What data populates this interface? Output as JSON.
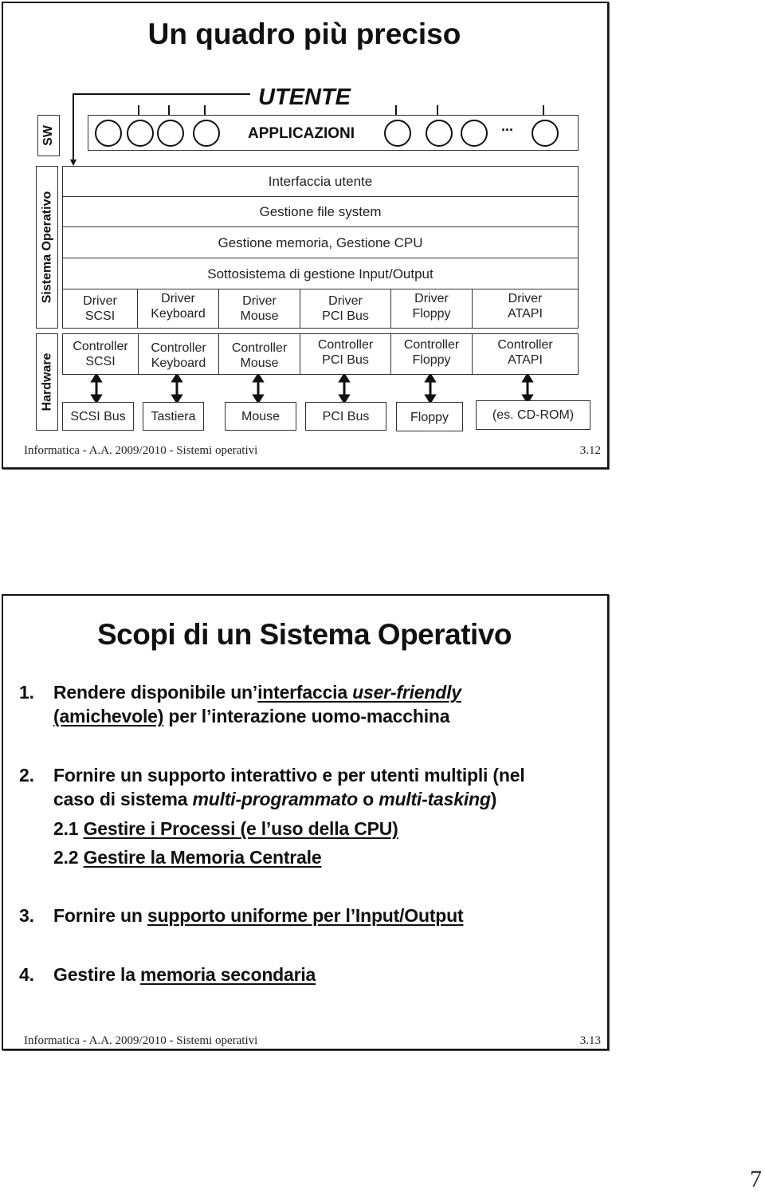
{
  "slide1": {
    "title": "Un quadro più preciso",
    "user_label": "UTENTE",
    "applications_label": "APPLICAZIONI",
    "ellipsis": "...",
    "side_labels": {
      "sw": "SW",
      "os": "Sistema Operativo",
      "hw": "Hardware"
    },
    "os_layers": [
      "Interfaccia utente",
      "Gestione file system",
      "Gestione memoria, Gestione CPU",
      "Sottosistema di gestione Input/Output"
    ],
    "drivers": [
      {
        "line1": "Driver",
        "line2": "SCSI"
      },
      {
        "line1": "Driver",
        "line2": "Keyboard"
      },
      {
        "line1": "Driver",
        "line2": "Mouse"
      },
      {
        "line1": "Driver",
        "line2": "PCI Bus"
      },
      {
        "line1": "Driver",
        "line2": "Floppy"
      },
      {
        "line1": "Driver",
        "line2": "ATAPI"
      }
    ],
    "controllers": [
      {
        "line1": "Controller",
        "line2": "SCSI"
      },
      {
        "line1": "Controller",
        "line2": "Keyboard"
      },
      {
        "line1": "Controller",
        "line2": "Mouse"
      },
      {
        "line1": "Controller",
        "line2": "PCI Bus"
      },
      {
        "line1": "Controller",
        "line2": "Floppy"
      },
      {
        "line1": "Controller",
        "line2": "ATAPI"
      }
    ],
    "devices": [
      "SCSI Bus",
      "Tastiera",
      "Mouse",
      "PCI Bus",
      "Floppy",
      "(es. CD-ROM)"
    ],
    "footer_left": "Informatica - A.A. 2009/2010 - Sistemi operativi",
    "footer_right": "3.12"
  },
  "slide2": {
    "title": "Scopi di un Sistema Operativo",
    "items": [
      {
        "num": "1.",
        "line1_a": "Rendere disponibile un’",
        "line1_b": "interfaccia ",
        "line1_c": "user-friendly",
        "line2_a": "(amichevole)",
        "line2_b": " per l’interazione uomo-macchina"
      },
      {
        "num": "2.",
        "line1": "Fornire un supporto interattivo e per utenti multipli (nel",
        "line2_a": "caso di sistema ",
        "line2_b": "multi-programmato",
        "line2_c": " o ",
        "line2_d": "multi-tasking",
        "line2_e": ")",
        "sub": [
          {
            "num": "2.1",
            "text": "Gestire i Processi (e l’uso della CPU)"
          },
          {
            "num": "2.2",
            "text": "Gestire la Memoria Centrale"
          }
        ]
      },
      {
        "num": "3.",
        "text_a": "Fornire un ",
        "text_b": "supporto uniforme per l’Input/Output"
      },
      {
        "num": "4.",
        "text_a": "Gestire la ",
        "text_b": "memoria secondaria"
      }
    ],
    "footer_left": "Informatica - A.A. 2009/2010 - Sistemi operativi",
    "footer_right": "3.13"
  },
  "page_number": "7"
}
